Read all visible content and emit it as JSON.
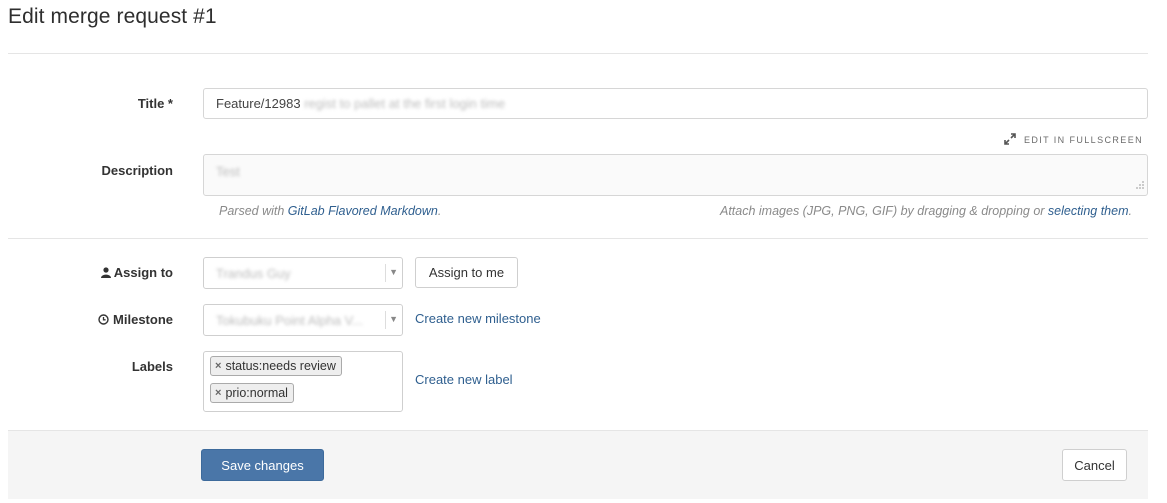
{
  "page": {
    "title": "Edit merge request #1"
  },
  "form": {
    "title": {
      "label": "Title *",
      "prefix": "Feature/12983",
      "value_blurred": "regist to pallet at the first login time"
    },
    "edit_fullscreen": "EDIT IN FULLSCREEN",
    "description": {
      "label": "Description",
      "value_blurred": "Test"
    },
    "hint_left": {
      "before": "Parsed with ",
      "link": "GitLab Flavored Markdown",
      "after": "."
    },
    "hint_right": {
      "before": "Attach images (JPG, PNG, GIF) by dragging & dropping or ",
      "link": "selecting them",
      "after": "."
    },
    "assign": {
      "label": "Assign to",
      "value_blurred": "Trandus Guy",
      "button": "Assign to me"
    },
    "milestone": {
      "label": "Milestone",
      "value_blurred": "Tokubuku Point Alpha V...",
      "link": "Create new milestone"
    },
    "labels": {
      "label": "Labels",
      "items": [
        "status:needs review",
        "prio:normal"
      ],
      "link": "Create new label"
    }
  },
  "footer": {
    "save": "Save changes",
    "cancel": "Cancel"
  },
  "colors": {
    "primary": "#4a76a8",
    "link": "#2f5f8f",
    "footer_bg": "#f5f5f5"
  },
  "icons": {
    "fullscreen": "expand-arrows-icon",
    "assign": "user-icon",
    "milestone": "clock-icon",
    "remove": "remove-x-icon"
  }
}
